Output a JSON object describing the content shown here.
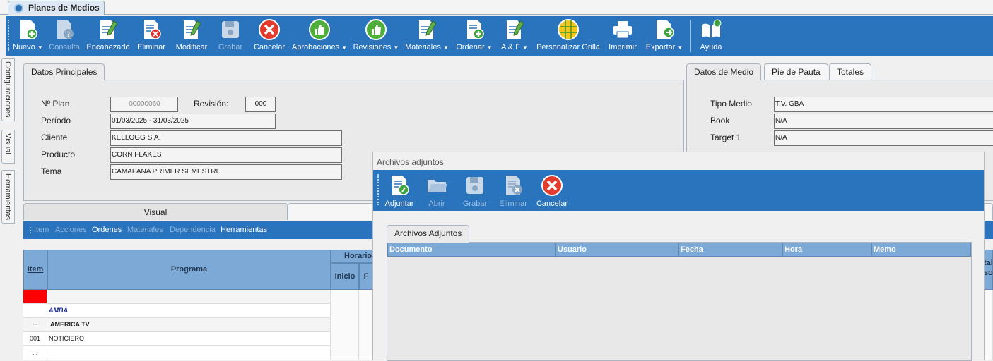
{
  "app": {
    "tab_title": "Planes de Medios"
  },
  "toolbar": {
    "buttons": [
      {
        "label": "Nuevo",
        "icon": "new-doc-icon",
        "dropdown": true,
        "enabled": true
      },
      {
        "label": "Consulta",
        "icon": "query-doc-icon",
        "dropdown": false,
        "enabled": false
      },
      {
        "label": "Encabezado",
        "icon": "edit-header-icon",
        "dropdown": false,
        "enabled": true
      },
      {
        "label": "Eliminar",
        "icon": "delete-doc-icon",
        "dropdown": false,
        "enabled": true
      },
      {
        "label": "Modificar",
        "icon": "edit-doc-icon",
        "dropdown": false,
        "enabled": true
      },
      {
        "label": "Grabar",
        "icon": "save-icon",
        "dropdown": false,
        "enabled": false
      },
      {
        "label": "Cancelar",
        "icon": "cancel-icon",
        "dropdown": false,
        "enabled": true
      },
      {
        "label": "Aprobaciones",
        "icon": "thumbs-up-icon",
        "dropdown": true,
        "enabled": true
      },
      {
        "label": "Revisiones",
        "icon": "thumbs-up-icon",
        "dropdown": true,
        "enabled": true
      },
      {
        "label": "Materiales",
        "icon": "edit-doc-icon",
        "dropdown": true,
        "enabled": true
      },
      {
        "label": "Ordenar",
        "icon": "new-doc-icon",
        "dropdown": true,
        "enabled": true
      },
      {
        "label": "A & F",
        "icon": "edit-doc-icon",
        "dropdown": true,
        "enabled": true
      },
      {
        "label": "Personalizar Grilla",
        "icon": "grid-globe-icon",
        "dropdown": false,
        "enabled": true
      },
      {
        "label": "Imprimir",
        "icon": "printer-icon",
        "dropdown": false,
        "enabled": true
      },
      {
        "label": "Exportar",
        "icon": "export-icon",
        "dropdown": true,
        "enabled": true
      },
      {
        "label": "Ayuda",
        "icon": "help-book-icon",
        "dropdown": false,
        "enabled": true
      }
    ]
  },
  "side_tabs": [
    "Configuraciones",
    "Visual",
    "Herramientas"
  ],
  "datos_principales": {
    "tab": "Datos Principales",
    "plan_label": "Nº Plan",
    "plan_value": "00000060",
    "revision_label": "Revisión:",
    "revision_value": "000",
    "periodo_label": "Período",
    "periodo_value": "01/03/2025 - 31/03/2025",
    "cliente_label": "Cliente",
    "cliente_value": "KELLOGG S.A.",
    "producto_label": "Producto",
    "producto_value": "CORN FLAKES",
    "tema_label": "Tema",
    "tema_value": "CAMAPANA PRIMER SEMESTRE"
  },
  "datos_medio": {
    "tabs": [
      "Datos de Medio",
      "Pie de Pauta",
      "Totales"
    ],
    "tipo_label": "Tipo Medio",
    "tipo_value": "T.V. GBA",
    "book_label": "Book",
    "book_value": "N/A",
    "target_label": "Target 1",
    "target_value": "N/A"
  },
  "lower_tabs": [
    "Visual"
  ],
  "subbar": [
    {
      "label": "Item",
      "enabled": false
    },
    {
      "label": "Acciones",
      "enabled": false
    },
    {
      "label": "Ordenes",
      "enabled": true
    },
    {
      "label": "Materiales",
      "enabled": false
    },
    {
      "label": "Dependencia",
      "enabled": false
    },
    {
      "label": "Herramientas",
      "enabled": true
    }
  ],
  "grid": {
    "headers": {
      "item": "Item",
      "programa": "Programa",
      "horario": "Horario",
      "inicio": "Inicio",
      "fin": "F"
    },
    "right_fragment_1": "tal",
    "right_fragment_2": "so",
    "rows": [
      {
        "item": "",
        "programa": ""
      },
      {
        "item": "",
        "programa": "AMBA"
      },
      {
        "item": "+",
        "programa": "AMERICA TV"
      },
      {
        "item": "001",
        "programa": "NOTICIERO"
      },
      {
        "item": "...",
        "programa": ""
      }
    ]
  },
  "dialog": {
    "title": "Archivos adjuntos",
    "buttons": [
      {
        "label": "Adjuntar",
        "icon": "attach-doc-icon",
        "enabled": true
      },
      {
        "label": "Abrir",
        "icon": "folder-open-icon",
        "enabled": false
      },
      {
        "label": "Grabar",
        "icon": "save-icon",
        "enabled": false
      },
      {
        "label": "Eliminar",
        "icon": "delete-doc-icon",
        "enabled": false
      },
      {
        "label": "Cancelar",
        "icon": "cancel-icon",
        "enabled": true
      }
    ],
    "tab": "Archivos Adjuntos",
    "columns": [
      "Documento",
      "Usuario",
      "Fecha",
      "Hora",
      "Memo"
    ]
  },
  "colors": {
    "toolbar_blue": "#2a73bd",
    "grid_header": "#7da9d6",
    "marker_red": "#ff0000"
  }
}
